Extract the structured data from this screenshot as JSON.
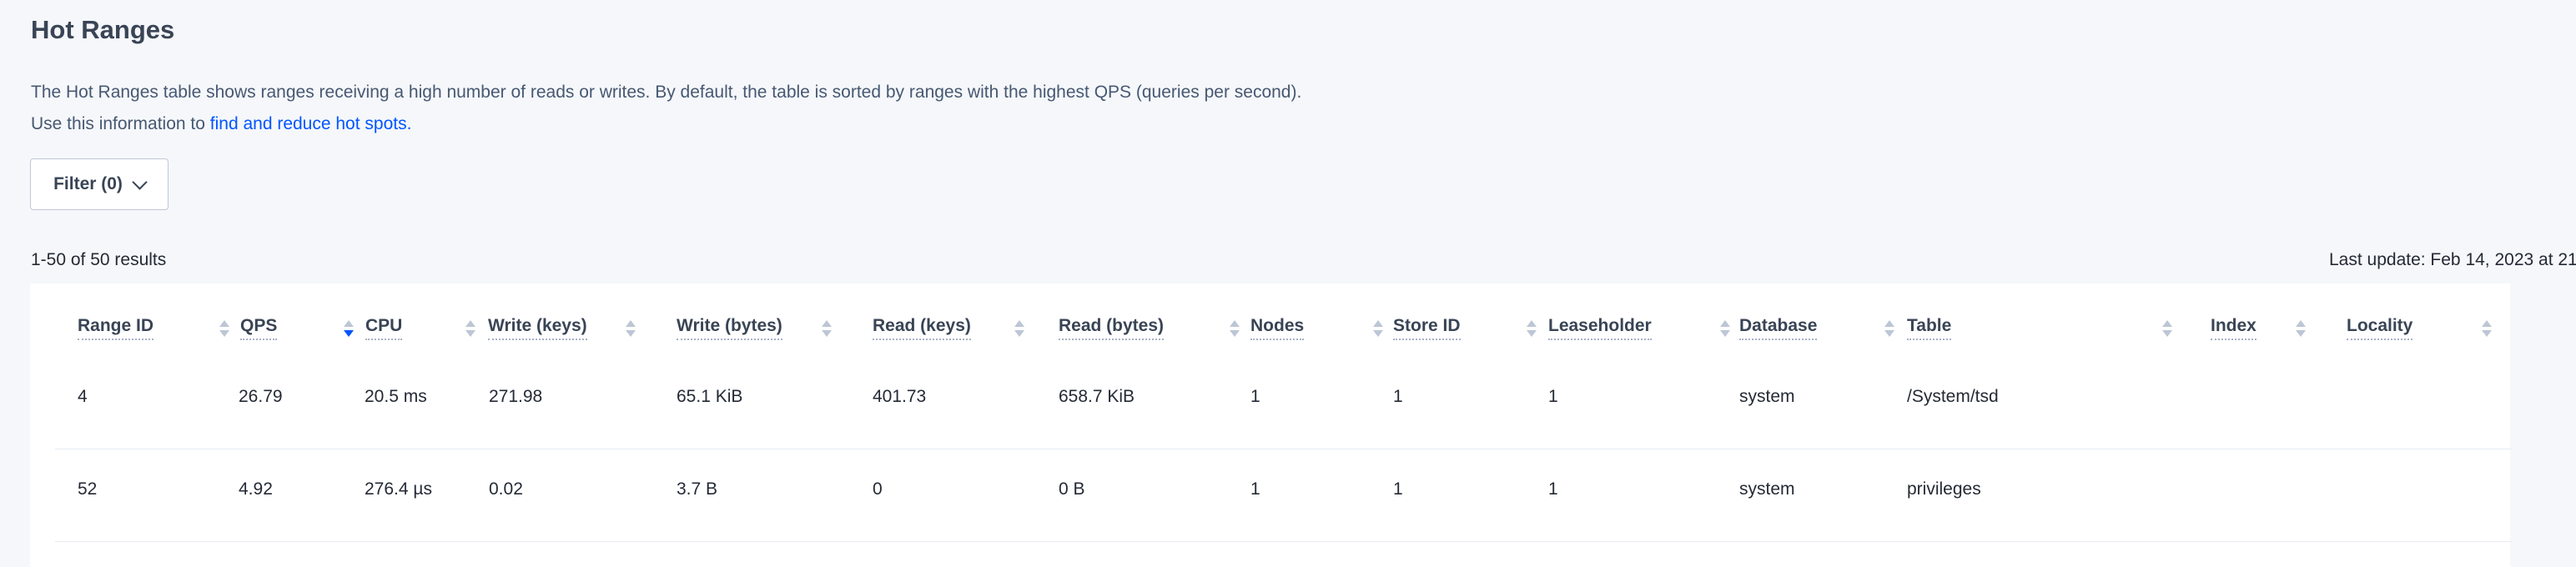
{
  "page": {
    "title": "Hot Ranges",
    "description_line1": "The Hot Ranges table shows ranges receiving a high number of reads or writes. By default, the table is sorted by ranges with the highest QPS (queries per second).",
    "description_line2_prefix": "Use this information to ",
    "description_line2_link": "find and reduce hot spots."
  },
  "filter": {
    "label": "Filter (0)"
  },
  "results": {
    "count_label": "1-50 of 50 results",
    "last_update": "Last update: Feb 14, 2023 at 21"
  },
  "table": {
    "columns": [
      {
        "label": "Range ID",
        "sorted": ""
      },
      {
        "label": "QPS",
        "sorted": "desc"
      },
      {
        "label": "CPU",
        "sorted": ""
      },
      {
        "label": "Write (keys)",
        "sorted": ""
      },
      {
        "label": "Write (bytes)",
        "sorted": ""
      },
      {
        "label": "Read (keys)",
        "sorted": ""
      },
      {
        "label": "Read (bytes)",
        "sorted": ""
      },
      {
        "label": "Nodes",
        "sorted": ""
      },
      {
        "label": "Store ID",
        "sorted": ""
      },
      {
        "label": "Leaseholder",
        "sorted": ""
      },
      {
        "label": "Database",
        "sorted": ""
      },
      {
        "label": "Table",
        "sorted": ""
      },
      {
        "label": "Index",
        "sorted": ""
      },
      {
        "label": "Locality",
        "sorted": ""
      }
    ],
    "rows": [
      [
        "4",
        "26.79",
        "20.5 ms",
        "271.98",
        "65.1 KiB",
        "401.73",
        "658.7 KiB",
        "1",
        "1",
        "1",
        "system",
        "/System/tsd",
        "",
        ""
      ],
      [
        "52",
        "4.92",
        "276.4 µs",
        "0.02",
        "3.7 B",
        "0",
        "0 B",
        "1",
        "1",
        "1",
        "system",
        "privileges",
        "",
        ""
      ]
    ]
  },
  "icons": {
    "filter_chevron": "chevron-down-icon",
    "sort": "sort-arrows-icon"
  },
  "colors": {
    "link": "#0055ff",
    "sort_active": "#0055ff",
    "sort_inactive": "#bcc6d6",
    "background": "#f5f7fa"
  }
}
